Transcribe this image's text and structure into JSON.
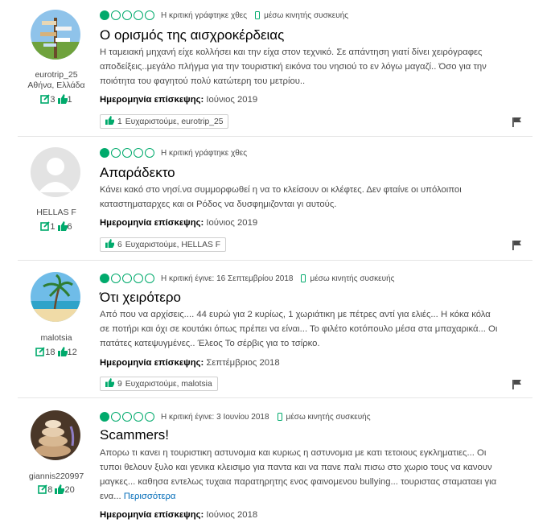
{
  "colors": {
    "accent": "#00aa6c",
    "link": "#006bb8",
    "title": "#000000"
  },
  "reviews": [
    {
      "username": "eurotrip_25",
      "location": "Αθήνα, Ελλάδα",
      "contributions": "3",
      "helpful_votes": "1",
      "rating": 1,
      "written": "Η κριτική γράφτηκε χθες",
      "via": "μέσω κινητής συσκευής",
      "title": "Ο ορισμός της αισχροκέρδειας",
      "body": "Η ταμειακή μηχανή είχε κολλήσει και την είχα στον τεχνικό. Σε απάντηση γιατί δίνει χειρόγραφες αποδείξεις..μεγάλο πλήγμα για την τουριστική εικόνα του νησιού το εν λόγω μαγαζί.. Όσο για την ποιότητα του φαγητού πολύ κατώτερη του μετρίου..",
      "visit_label": "Ημερομηνία επίσκεψης:",
      "visit_date": "Ιούνιος 2019",
      "thanks_count": "1",
      "thanks_text": "Ευχαριστούμε, eurotrip_25"
    },
    {
      "username": "HELLAS F",
      "contributions": "1",
      "helpful_votes": "6",
      "rating": 1,
      "written": "Η κριτική γράφτηκε χθες",
      "title": "Απαράδεκτο",
      "body": "Κάνει κακό στο νησί.να συμμορφωθεί η να το κλείσουν οι κλέφτες. Δεν φταίνε οι υπόλοιποι καταστηματαρχες και οι Ρόδος να δυσφημιζονται γι αυτούς.",
      "visit_label": "Ημερομηνία επίσκεψης:",
      "visit_date": "Ιούνιος 2019",
      "thanks_count": "6",
      "thanks_text": "Ευχαριστούμε, HELLAS F"
    },
    {
      "username": "malotsia",
      "contributions": "18",
      "helpful_votes": "12",
      "rating": 1,
      "written": "Η κριτική έγινε: 16 Σεπτεμβρίου 2018",
      "via": "μέσω κινητής συσκευής",
      "title": "Ότι χειρότερο",
      "body": "Από που να αρχίσεις.... 44 ευρώ για 2 κυρίως, 1 χωριάτικη με πέτρες αντί για ελιές... Η κόκα κόλα σε ποτήρι και όχι σε κουτάκι όπως πρέπει να είναι... Το φιλέτο κοτόπουλο μέσα στα μπαχαρικά... Οι πατάτες κατεψυγμένες.. Έλεος Το σέρβις για το τσίρκο.",
      "visit_label": "Ημερομηνία επίσκεψης:",
      "visit_date": "Σεπτέμβριος 2018",
      "thanks_count": "9",
      "thanks_text": "Ευχαριστούμε, malotsia"
    },
    {
      "username": "giannis220997",
      "contributions": "8",
      "helpful_votes": "20",
      "rating": 1,
      "written": "Η κριτική έγινε: 3 Ιουνίου 2018",
      "via": "μέσω κινητής συσκευής",
      "title": "Scammers!",
      "body": "Απορω τι κανει η τουριστικη αστυνομια και κυριως η αστυνομια με κατι τετοιους εγκληματιες... Οι τυποι θελουν ξυλο και γενικα κλεισιμο για παντα και να πανε παλι πισω στο χωριο τους να κανουν μαγκες... καθησα εντελως τυχαια παρατηρητης ενος φαινομενου bullying... τουριστας σταματαει για ενα...",
      "more": "Περισσότερα",
      "visit_label": "Ημερομηνία επίσκεψης:",
      "visit_date": "Ιούνιος 2018"
    }
  ]
}
